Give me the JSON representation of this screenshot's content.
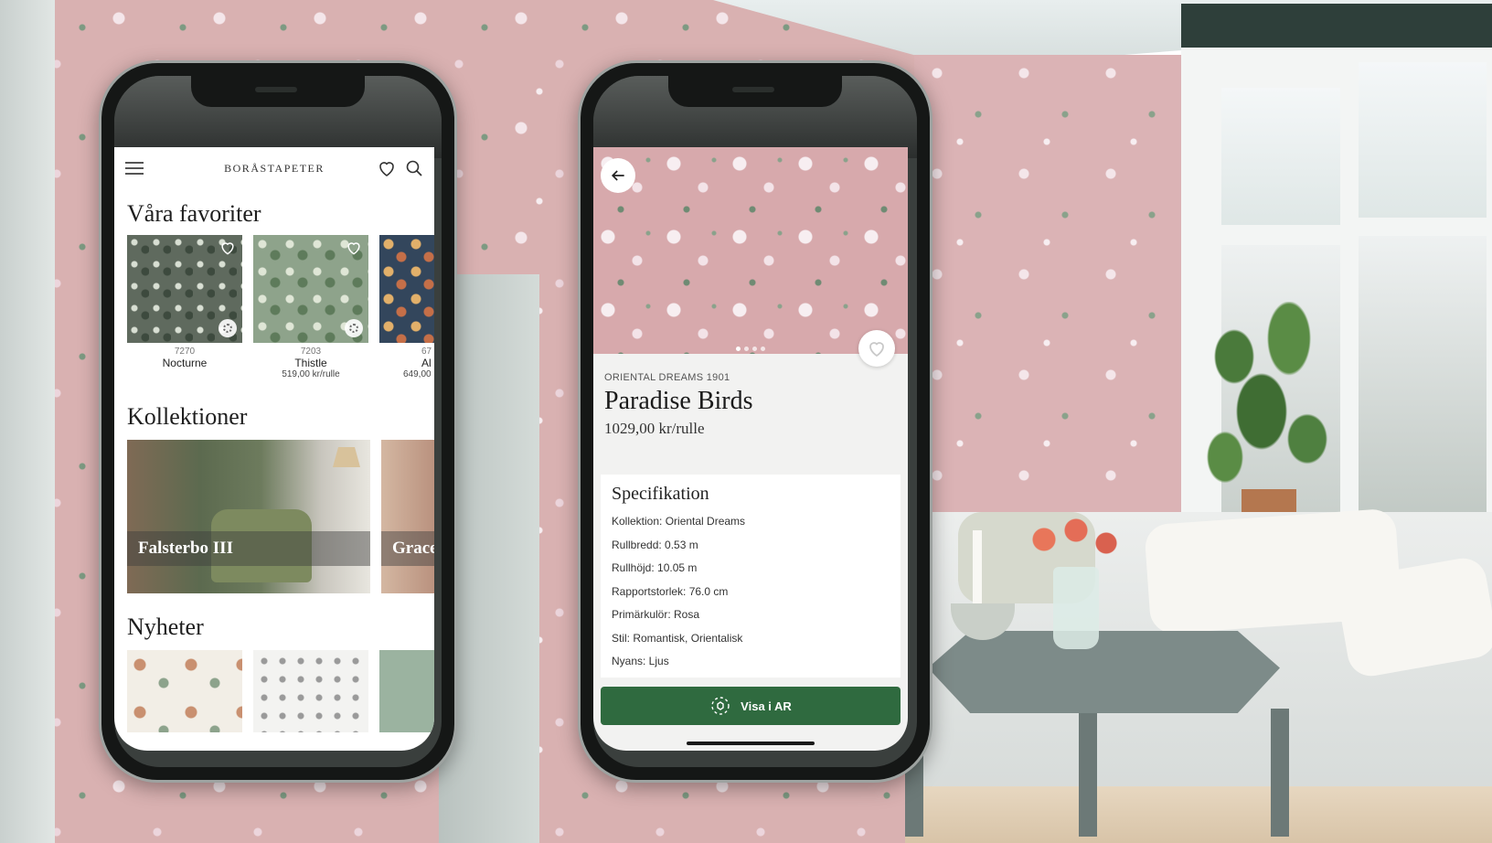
{
  "colors": {
    "accent_green": "#2f6a3f",
    "wall_pink": "#d9b1b1",
    "phone_frame": "#151716"
  },
  "left_phone": {
    "header": {
      "brand": "BORÅSTAPETER",
      "icons": [
        "menu-icon",
        "heart-icon",
        "search-icon"
      ]
    },
    "favorites": {
      "title": "Våra favoriter",
      "items": [
        {
          "code": "7270",
          "name": "Nocturne",
          "price": ""
        },
        {
          "code": "7203",
          "name": "Thistle",
          "price": "519,00 kr/rulle"
        },
        {
          "code": "67",
          "name": "Al",
          "price": "649,00"
        }
      ]
    },
    "collections": {
      "title": "Kollektioner",
      "items": [
        {
          "label": "Falsterbo III"
        },
        {
          "label": "Grace"
        }
      ]
    },
    "news": {
      "title": "Nyheter"
    }
  },
  "right_phone": {
    "collection": "ORIENTAL DREAMS 1901",
    "title": "Paradise Birds",
    "price": "1029,00 kr/rulle",
    "spec": {
      "title": "Specifikation",
      "lines": [
        "Kollektion: Oriental Dreams",
        "Rullbredd: 0.53 m",
        "Rullhöjd: 10.05 m",
        "Rapportstorlek: 76.0 cm",
        "Primärkulör: Rosa",
        "Stil: Romantisk, Orientalisk",
        "Nyans: Ljus"
      ]
    },
    "ar_button": "Visa i AR"
  }
}
